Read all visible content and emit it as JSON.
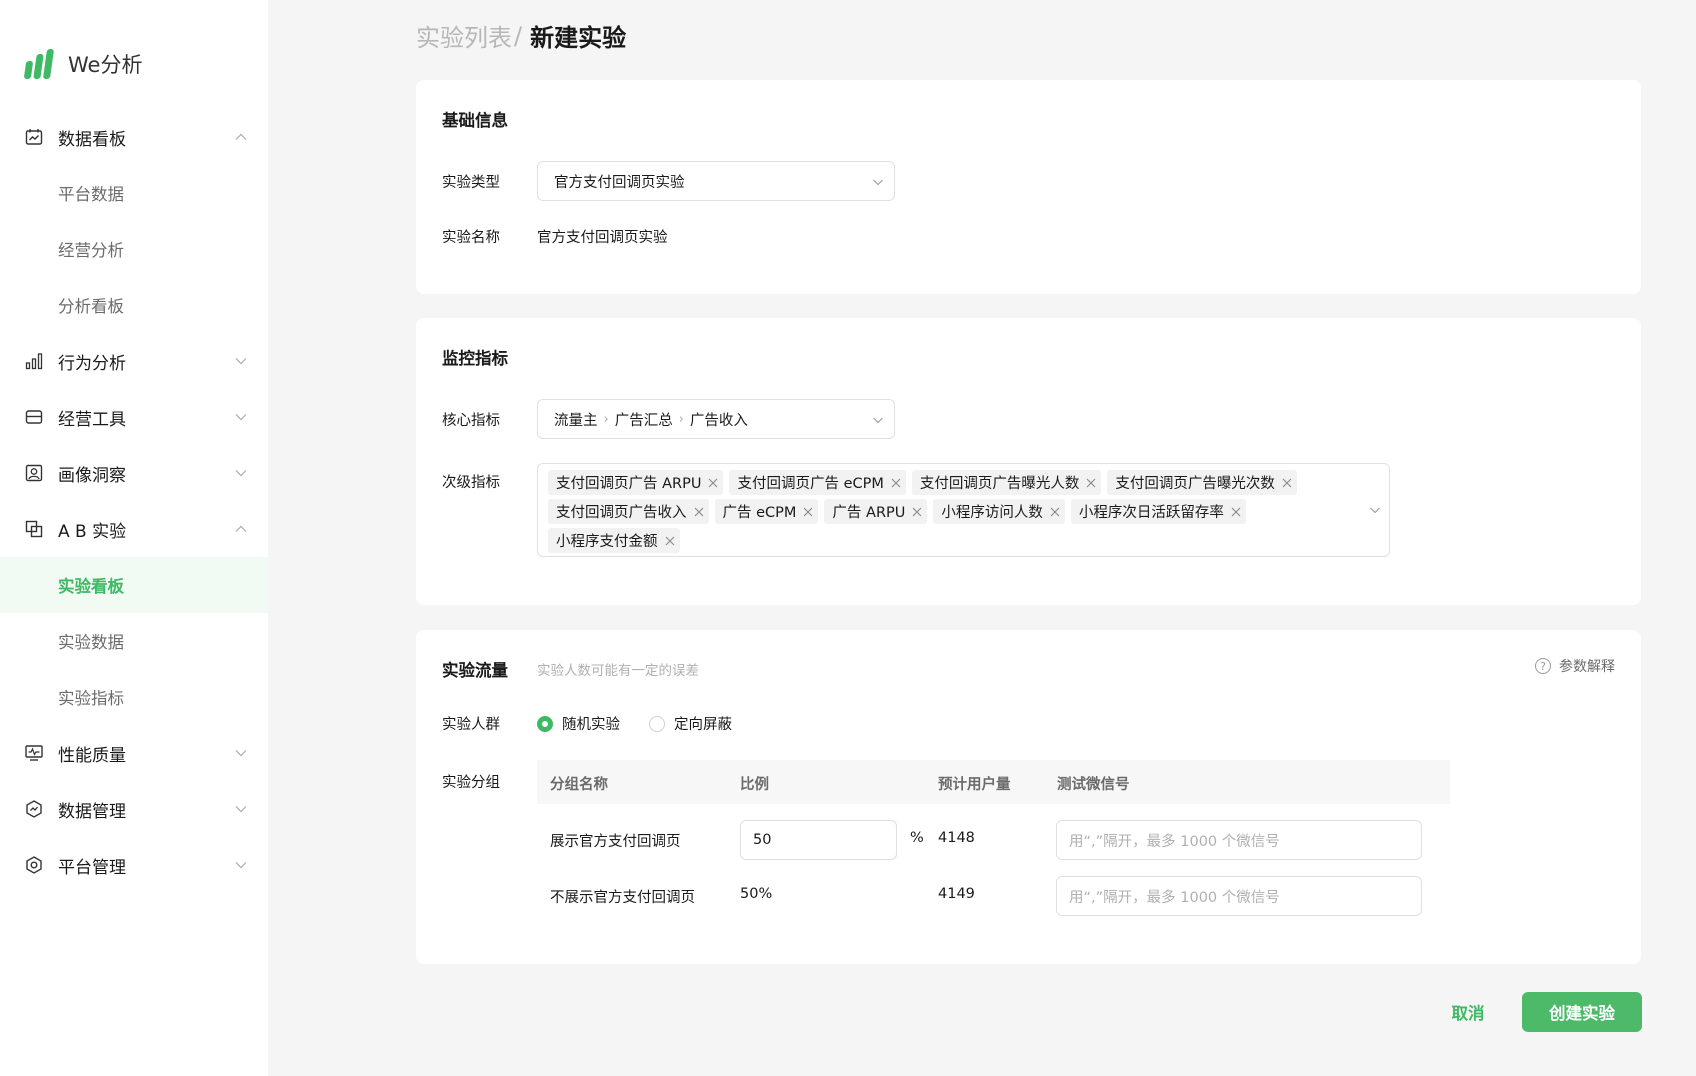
{
  "app": {
    "name": "We分析"
  },
  "sidebar": {
    "groups": [
      {
        "label": "数据看板",
        "icon": "calendar-chart-icon",
        "expanded": true,
        "items": [
          {
            "label": "平台数据"
          },
          {
            "label": "经营分析"
          },
          {
            "label": "分析看板"
          }
        ]
      },
      {
        "label": "行为分析",
        "icon": "bar-chart-icon",
        "expanded": false
      },
      {
        "label": "经营工具",
        "icon": "store-icon",
        "expanded": false
      },
      {
        "label": "画像洞察",
        "icon": "portrait-icon",
        "expanded": false
      },
      {
        "label": "A B 实验",
        "icon": "ab-test-icon",
        "expanded": true,
        "items": [
          {
            "label": "实验看板",
            "active": true
          },
          {
            "label": "实验数据"
          },
          {
            "label": "实验指标"
          }
        ]
      },
      {
        "label": "性能质量",
        "icon": "monitor-icon",
        "expanded": false
      },
      {
        "label": "数据管理",
        "icon": "data-manage-icon",
        "expanded": false
      },
      {
        "label": "平台管理",
        "icon": "settings-hex-icon",
        "expanded": false
      }
    ]
  },
  "breadcrumb": {
    "parent": "实验列表",
    "separator": "/",
    "current": "新建实验"
  },
  "basic_info": {
    "title": "基础信息",
    "type_label": "实验类型",
    "type_value": "官方支付回调页实验",
    "name_label": "实验名称",
    "name_value": "官方支付回调页实验"
  },
  "metrics": {
    "title": "监控指标",
    "core_label": "核心指标",
    "core_path": [
      "流量主",
      "广告汇总",
      "广告收入"
    ],
    "secondary_label": "次级指标",
    "secondary_tags": [
      [
        "支付回调页广告 ARPU",
        "支付回调页广告 eCPM",
        "支付回调页广告曝光人数",
        "支付回调页广告曝光次数"
      ],
      [
        "支付回调页广告收入",
        "广告 eCPM",
        "广告 ARPU",
        "小程序访问人数",
        "小程序次日活跃留存率"
      ],
      [
        "小程序支付金额"
      ]
    ]
  },
  "traffic": {
    "title": "实验流量",
    "subtitle": "实验人数可能有一定的误差",
    "help_label": "参数解释",
    "crowd_label": "实验人群",
    "crowd_options": [
      {
        "label": "随机实验",
        "checked": true
      },
      {
        "label": "定向屏蔽",
        "checked": false
      }
    ],
    "group_label": "实验分组",
    "columns": [
      "分组名称",
      "比例",
      "预计用户量",
      "测试微信号"
    ],
    "rows": [
      {
        "name": "展示官方支付回调页",
        "ratio": "50",
        "unit": "%",
        "users": "4148",
        "wechat_placeholder": "用“,”隔开，最多 1000 个微信号"
      },
      {
        "name": "不展示官方支付回调页",
        "ratio": "50%",
        "users": "4149",
        "wechat_placeholder": "用“,”隔开，最多 1000 个微信号"
      }
    ]
  },
  "actions": {
    "cancel": "取消",
    "create": "创建实验"
  },
  "colors": {
    "accent": "#3fb964",
    "primary_button": "#4cba68",
    "background": "#f5f5f5",
    "active_nav_bg": "#f2faf4"
  }
}
